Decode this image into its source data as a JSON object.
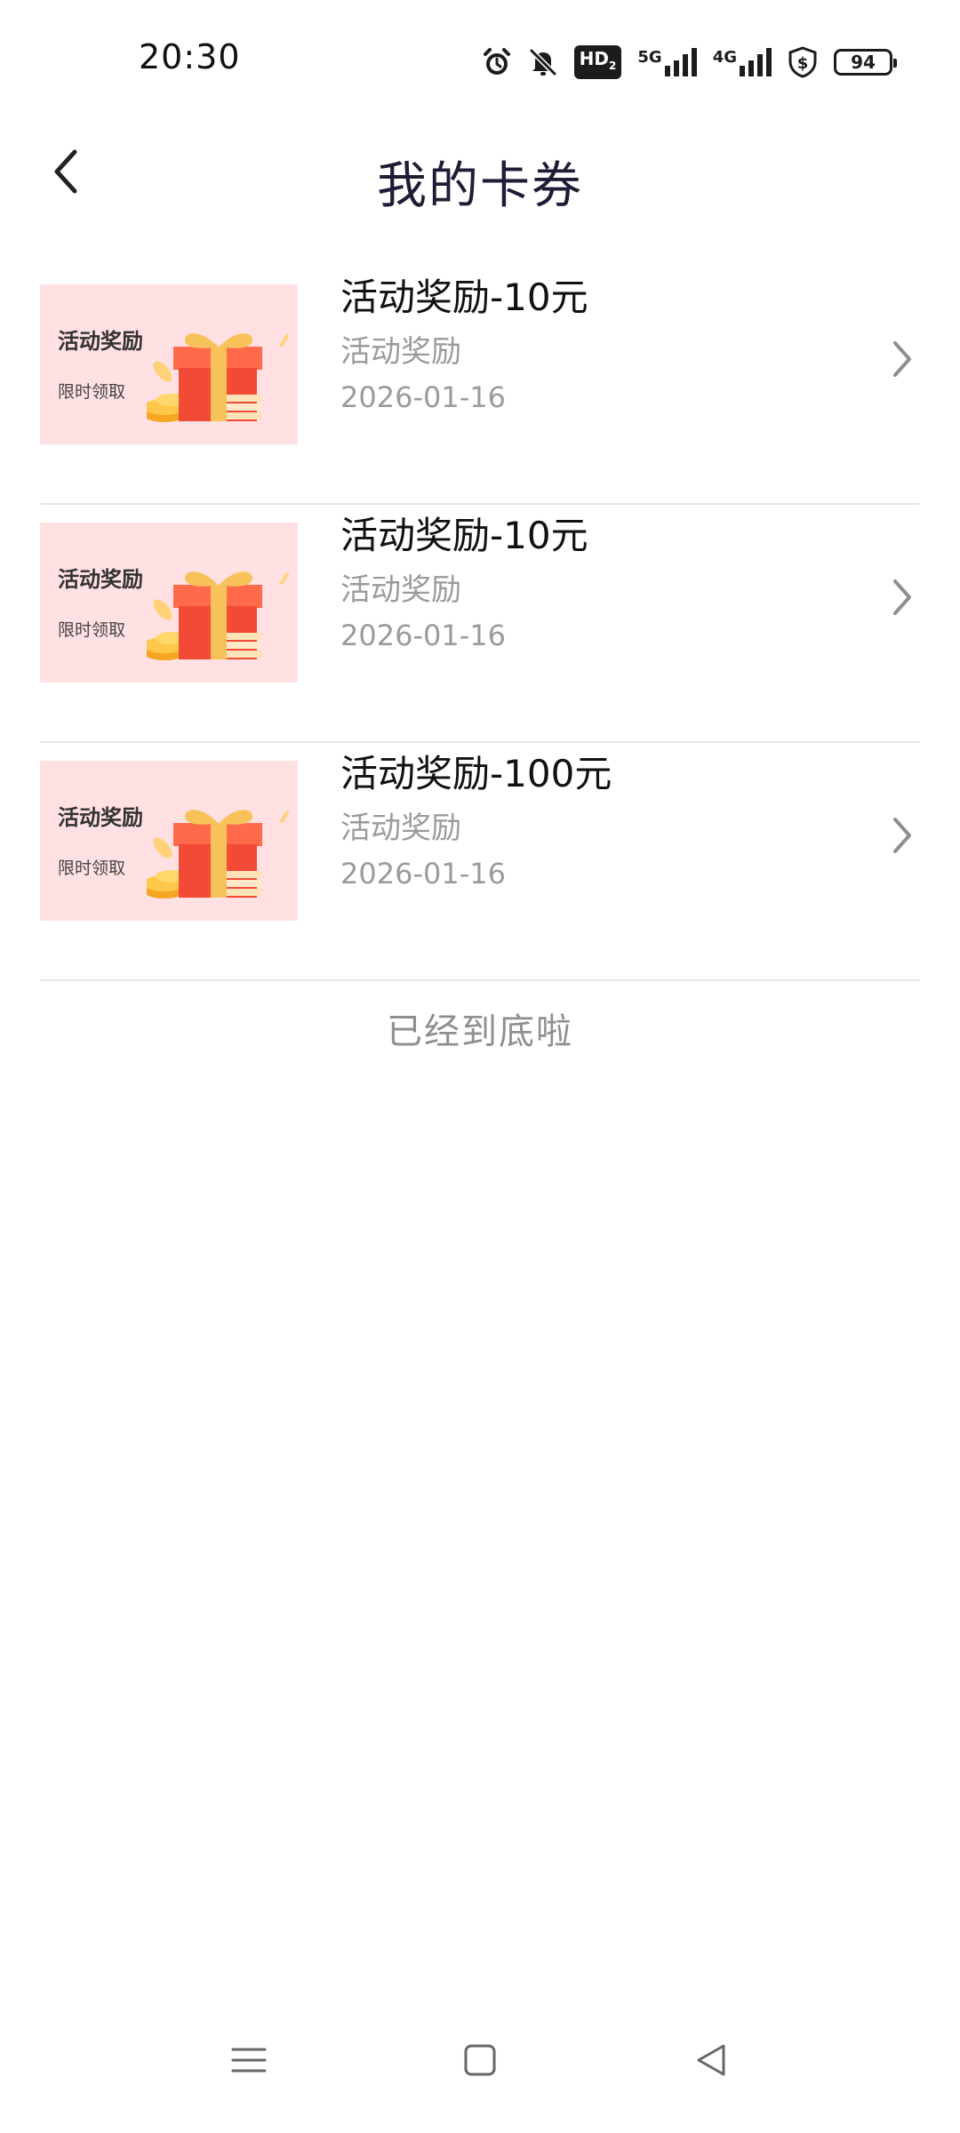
{
  "status_bar": {
    "time": "20:30",
    "hd_label": "HD",
    "hd_sub": "2",
    "network_1": "5G",
    "network_2": "4G",
    "battery": "94",
    "icons": [
      "alarm-icon",
      "mute-icon",
      "hd-icon",
      "signal-5g-icon",
      "signal-4g-icon",
      "shield-dollar-icon",
      "battery-icon"
    ]
  },
  "header": {
    "title": "我的卡券",
    "back_icon": "chevron-left-icon"
  },
  "coupons": [
    {
      "thumb_title": "活动奖励",
      "thumb_sub": "限时领取",
      "title": "活动奖励-10元",
      "type": "活动奖励",
      "date": "2026-01-16"
    },
    {
      "thumb_title": "活动奖励",
      "thumb_sub": "限时领取",
      "title": "活动奖励-10元",
      "type": "活动奖励",
      "date": "2026-01-16"
    },
    {
      "thumb_title": "活动奖励",
      "thumb_sub": "限时领取",
      "title": "活动奖励-100元",
      "type": "活动奖励",
      "date": "2026-01-16"
    }
  ],
  "end_text": "已经到底啦",
  "nav_bar": {
    "icons": [
      "menu-icon",
      "home-square-icon",
      "back-triangle-icon"
    ]
  },
  "colors": {
    "thumb_bg": "#ffe1e3",
    "gift_red": "#f24a36",
    "ribbon_gold": "#f7c25a",
    "secondary_text": "#9b9b9b",
    "divider": "#e6e6e6"
  }
}
